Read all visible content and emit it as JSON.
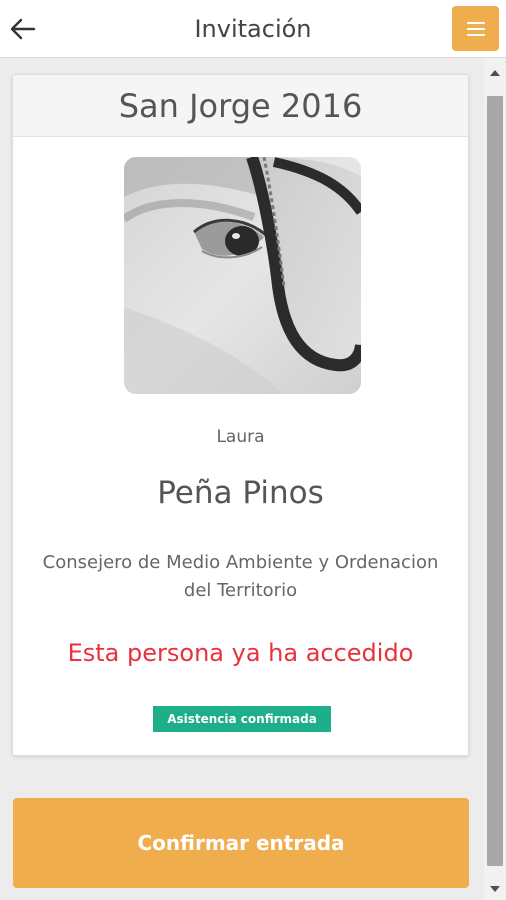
{
  "header": {
    "title": "Invitación",
    "back_icon": "arrow-left-icon",
    "menu_icon": "hamburger-menu-icon"
  },
  "card": {
    "event_title": "San Jorge 2016",
    "first_name": "Laura",
    "last_name": "Peña Pinos",
    "position": "Consejero de Medio Ambiente y Ordenacion del Territorio",
    "access_message": "Esta persona ya ha accedido",
    "status_badge": "Asistencia confirmada"
  },
  "actions": {
    "confirm_label": "Confirmar entrada"
  },
  "colors": {
    "accent": "#f0ad4e",
    "alert_red": "#e8323c",
    "badge_green": "#1fae8a"
  }
}
